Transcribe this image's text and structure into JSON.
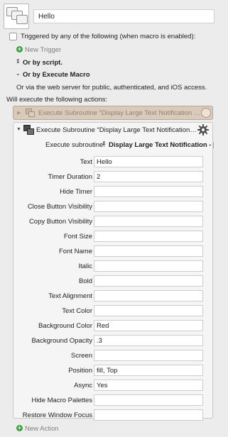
{
  "macro": {
    "name": "Hello",
    "icon": "macro-windows-icon"
  },
  "triggers": {
    "heading": "Triggered by any of the following (when macro is enabled):",
    "new_trigger_label": "New Trigger",
    "by_script_label": "Or by script.",
    "by_execute_macro_label": "Or by Execute Macro",
    "web_server_text": "Or via the web server for public, authenticated, and iOS access."
  },
  "actions": {
    "heading": "Will execute the following actions:",
    "collapsed_action_label": "Execute Subroutine “Display Large Text Notification – Reference”",
    "expanded_action_label": "Execute Subroutine “Display Large Text Notification – Reference”",
    "subroutine_label": "Execute subroutine:",
    "subroutine_value": "Display Large Text Notification - [Reference]",
    "new_action_label": "New Action",
    "params": [
      {
        "label": "Text",
        "value": "Hello"
      },
      {
        "label": "Timer Duration",
        "value": "2"
      },
      {
        "label": "Hide Timer",
        "value": ""
      },
      {
        "label": "Close Button Visibility",
        "value": ""
      },
      {
        "label": "Copy Button Visibility",
        "value": ""
      },
      {
        "label": "Font Size",
        "value": ""
      },
      {
        "label": "Font Name",
        "value": ""
      },
      {
        "label": "Italic",
        "value": ""
      },
      {
        "label": "Bold",
        "value": ""
      },
      {
        "label": "Text Alignment",
        "value": ""
      },
      {
        "label": "Text Color",
        "value": ""
      },
      {
        "label": "Background Color",
        "value": "Red"
      },
      {
        "label": "Background Opacity",
        "value": ".3"
      },
      {
        "label": "Screen",
        "value": ""
      },
      {
        "label": "Position",
        "value": "fill, Top"
      },
      {
        "label": "Async",
        "value": "Yes"
      },
      {
        "label": "Hide Macro Palettes",
        "value": ""
      },
      {
        "label": "Restore Window Focus",
        "value": ""
      }
    ]
  },
  "colors": {
    "collapsed_bg": "#dacaba",
    "add_green": "#3fa03f",
    "panel_bg": "#ececec"
  }
}
